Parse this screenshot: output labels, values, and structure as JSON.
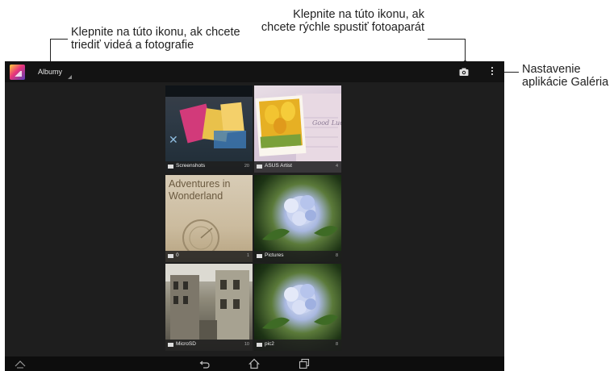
{
  "callouts": {
    "albums": "Klepnite na túto ikonu, ak chcete triediť videá a fotografie",
    "camera": "Klepnite na túto ikonu, ak chcete rýchle spustiť fotoaparát",
    "settings": "Nastavenie aplikácie Galéria"
  },
  "actionbar": {
    "title": "Albumy",
    "icons": [
      "gallery-app-icon",
      "camera-icon",
      "overflow-menu-icon"
    ]
  },
  "albums": [
    {
      "name": "Screenshots",
      "count": "20"
    },
    {
      "name": "ASUS Artist",
      "count": "4"
    },
    {
      "name": "0",
      "count": "1"
    },
    {
      "name": "Pictures",
      "count": "8"
    },
    {
      "name": "MicroSD",
      "count": "10"
    },
    {
      "name": "pic2",
      "count": "8"
    }
  ],
  "tile_art": {
    "adventures": "Adventures in Wonderland",
    "good_luck": "Good Luck"
  },
  "navbar": {
    "icons": [
      "expand-up-icon",
      "back-icon",
      "home-icon",
      "recent-apps-icon"
    ]
  },
  "colors": {
    "screen_bg": "#1e1e1e",
    "actionbar_bg": "#131313",
    "navbar_bg": "#0d0d0d"
  }
}
